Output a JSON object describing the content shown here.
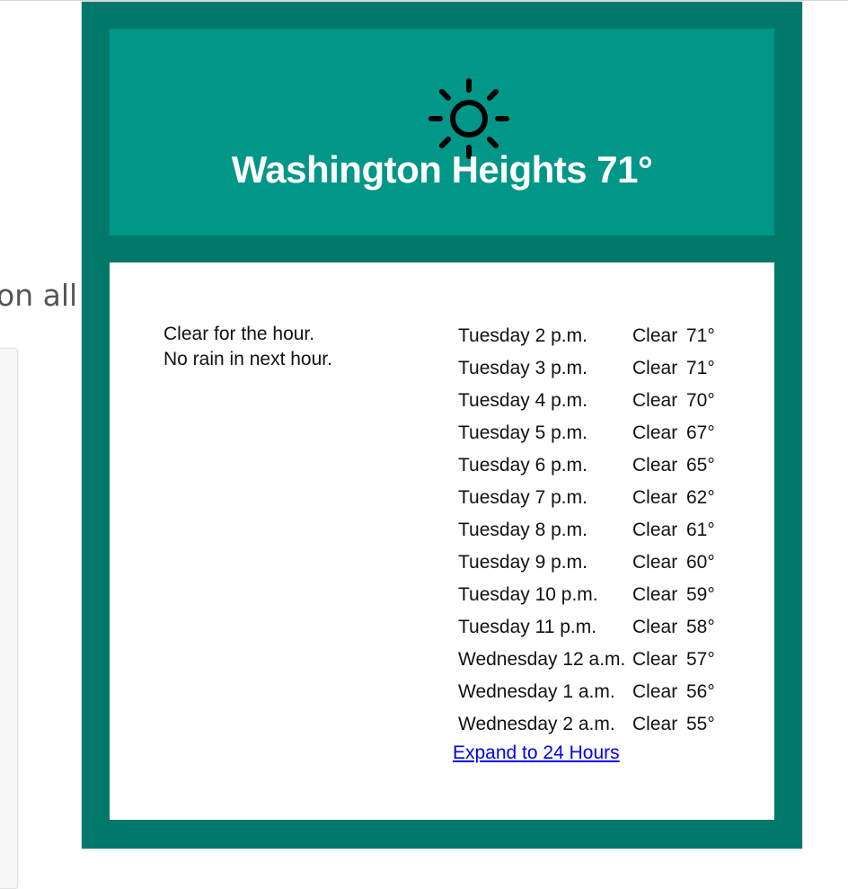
{
  "background": {
    "partial_text": "on all y"
  },
  "header": {
    "icon": "sun-icon",
    "title": "Washington Heights 71°",
    "color": "#009688",
    "frame_color": "#00796b"
  },
  "summary": {
    "line1": "Clear for the hour.",
    "line2": "No rain in next hour."
  },
  "hourly": [
    {
      "time": "Tuesday 2 p.m.",
      "condition": "Clear",
      "temp": "71°"
    },
    {
      "time": "Tuesday 3 p.m.",
      "condition": "Clear",
      "temp": "71°"
    },
    {
      "time": "Tuesday 4 p.m.",
      "condition": "Clear",
      "temp": "70°"
    },
    {
      "time": "Tuesday 5 p.m.",
      "condition": "Clear",
      "temp": "67°"
    },
    {
      "time": "Tuesday 6 p.m.",
      "condition": "Clear",
      "temp": "65°"
    },
    {
      "time": "Tuesday 7 p.m.",
      "condition": "Clear",
      "temp": "62°"
    },
    {
      "time": "Tuesday 8 p.m.",
      "condition": "Clear",
      "temp": "61°"
    },
    {
      "time": "Tuesday 9 p.m.",
      "condition": "Clear",
      "temp": "60°"
    },
    {
      "time": "Tuesday 10 p.m.",
      "condition": "Clear",
      "temp": "59°"
    },
    {
      "time": "Tuesday 11 p.m.",
      "condition": "Clear",
      "temp": "58°"
    },
    {
      "time": "Wednesday 12 a.m.",
      "condition": "Clear",
      "temp": "57°"
    },
    {
      "time": "Wednesday 1 a.m.",
      "condition": "Clear",
      "temp": "56°"
    },
    {
      "time": "Wednesday 2 a.m.",
      "condition": "Clear",
      "temp": "55°"
    }
  ],
  "expand_link": "Expand to 24 Hours"
}
